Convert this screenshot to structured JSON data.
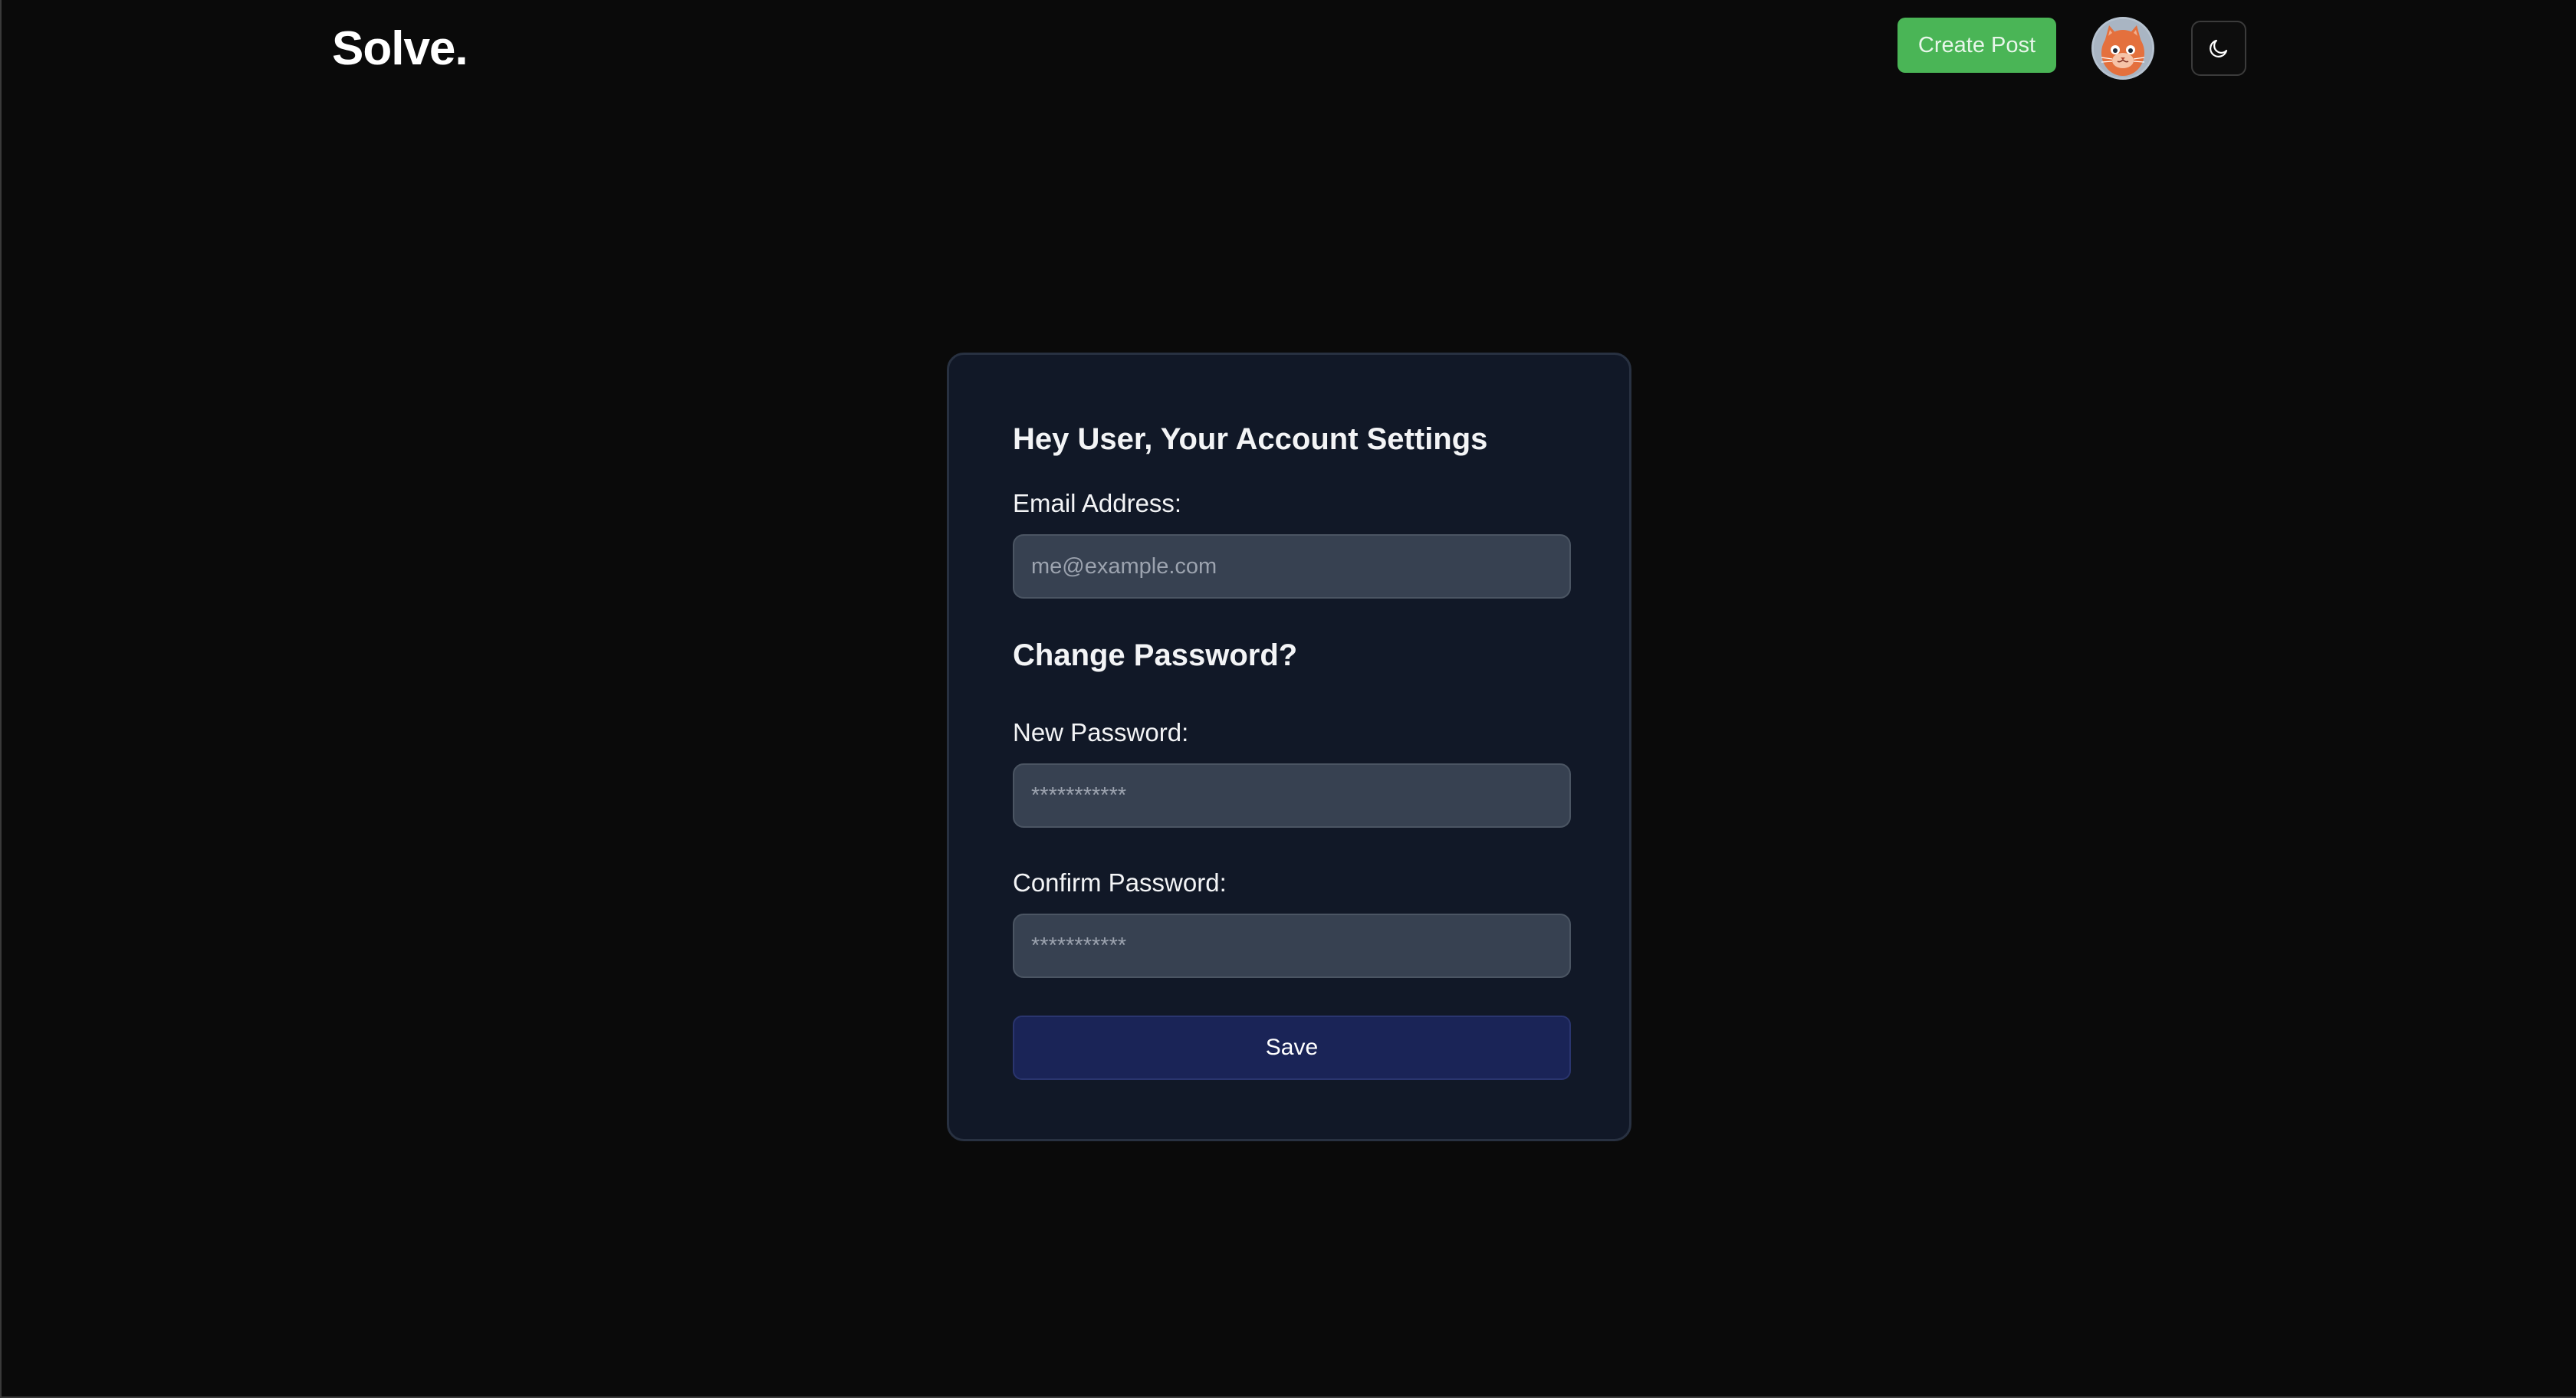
{
  "header": {
    "logo": "Solve.",
    "create_post_label": "Create Post",
    "avatar_icon": "cat-avatar-icon",
    "theme_toggle_icon": "moon-icon"
  },
  "settings": {
    "title": "Hey User, Your Account Settings",
    "email_label": "Email Address:",
    "email_placeholder": "me@example.com",
    "email_value": "",
    "password_section_title": "Change Password?",
    "new_password_label": "New Password:",
    "new_password_placeholder": "***********",
    "confirm_password_label": "Confirm Password:",
    "confirm_password_placeholder": "***********",
    "save_label": "Save"
  },
  "colors": {
    "background": "#0a0a0a",
    "card": "#111827",
    "input": "#374151",
    "accent_green": "#4ab556",
    "save_button": "#1a2457"
  }
}
